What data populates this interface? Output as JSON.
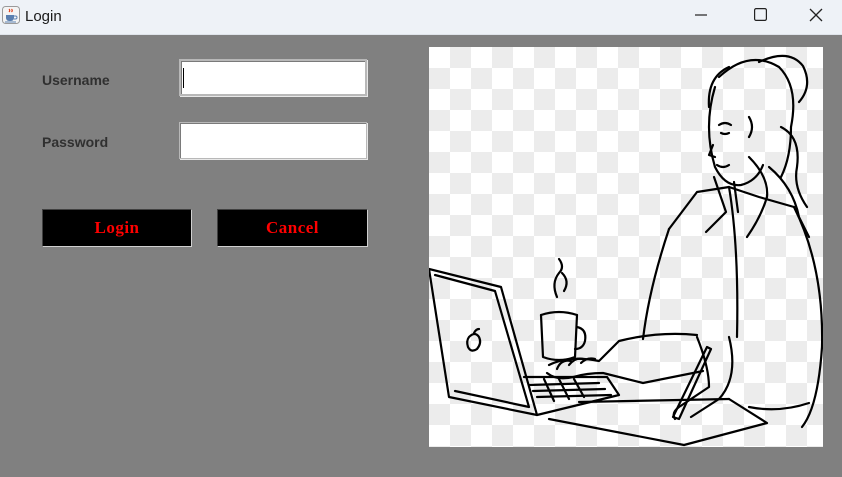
{
  "window": {
    "title": "Login",
    "icon": "java-cup-icon",
    "controls": [
      "minimize-icon",
      "maximize-icon",
      "close-icon"
    ]
  },
  "form": {
    "username_label": "Username",
    "username_value": "",
    "password_label": "Password",
    "password_value": ""
  },
  "buttons": {
    "login_label": "Login",
    "cancel_label": "Cancel"
  },
  "illustration": {
    "subject": "woman-working-on-laptop-line-drawing"
  },
  "colors": {
    "background": "#808080",
    "button_bg": "#000000",
    "button_text": "#ff0000",
    "titlebar": "#eef2f7"
  }
}
